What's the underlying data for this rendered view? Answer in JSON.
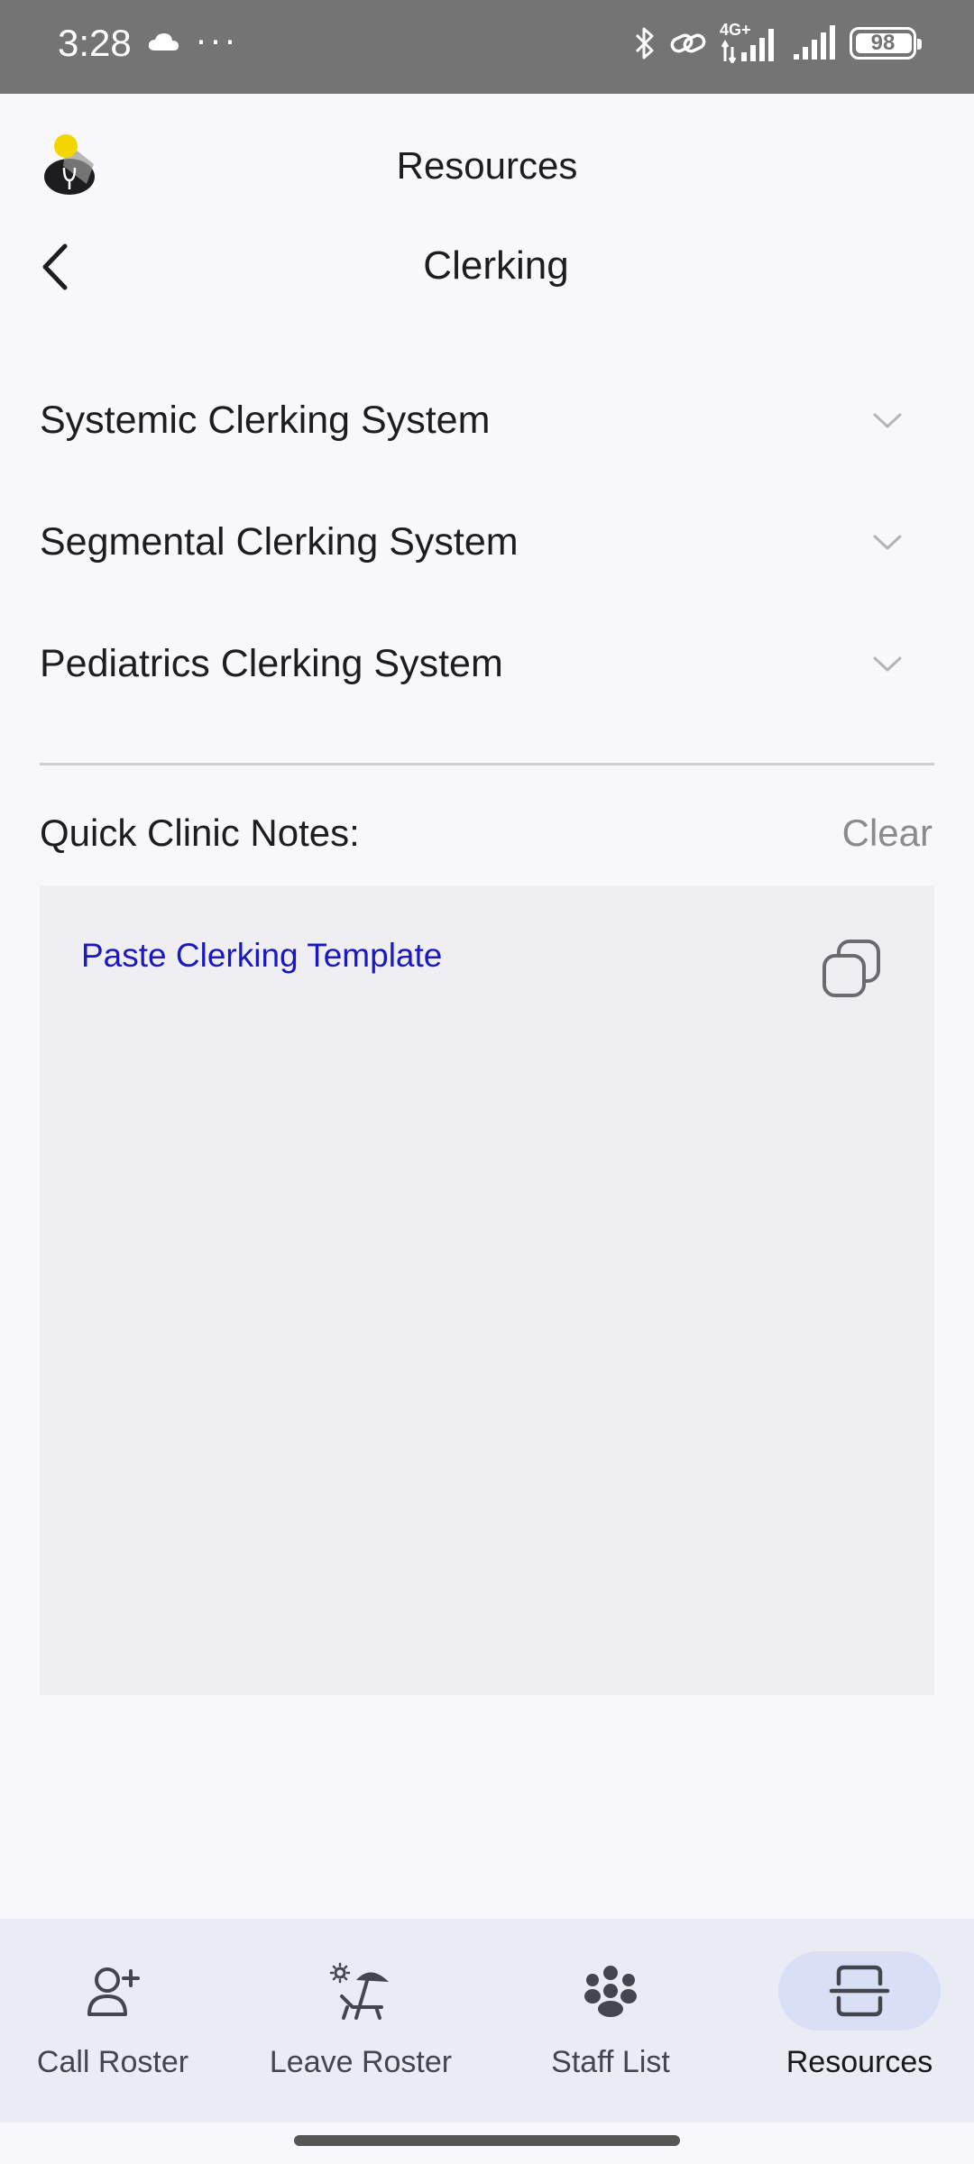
{
  "status_bar": {
    "time": "3:28",
    "more_indicator": "···",
    "network_label": "4G+",
    "battery": "98",
    "icons": [
      "cloud-icon",
      "bluetooth-icon",
      "link-icon",
      "signal-icon",
      "signal-icon-2",
      "battery-icon"
    ]
  },
  "header": {
    "title": "Resources",
    "logo": "stethoscope-bulb-logo"
  },
  "page": {
    "title": "Clerking",
    "back_icon": "chevron-left-icon"
  },
  "accordions": [
    {
      "label": "Systemic Clerking System"
    },
    {
      "label": "Segmental Clerking System"
    },
    {
      "label": "Pediatrics Clerking System"
    }
  ],
  "notes": {
    "label": "Quick Clinic Notes:",
    "clear_label": "Clear",
    "paste_link": "Paste Clerking Template",
    "copy_icon": "copy-icon"
  },
  "bottom_nav": {
    "active": "Resources",
    "items": [
      {
        "label": "Call Roster",
        "icon": "person-add-icon"
      },
      {
        "label": "Leave Roster",
        "icon": "beach-chair-icon"
      },
      {
        "label": "Staff List",
        "icon": "group-icon"
      },
      {
        "label": "Resources",
        "icon": "document-scanner-icon"
      }
    ]
  },
  "colors": {
    "status_bar": "#747474",
    "background": "#f8f8fc",
    "notes_area": "#efeff3",
    "link": "#1a18c2",
    "nav_background": "#eaecf4",
    "nav_active_pill": "#d9dff5"
  }
}
